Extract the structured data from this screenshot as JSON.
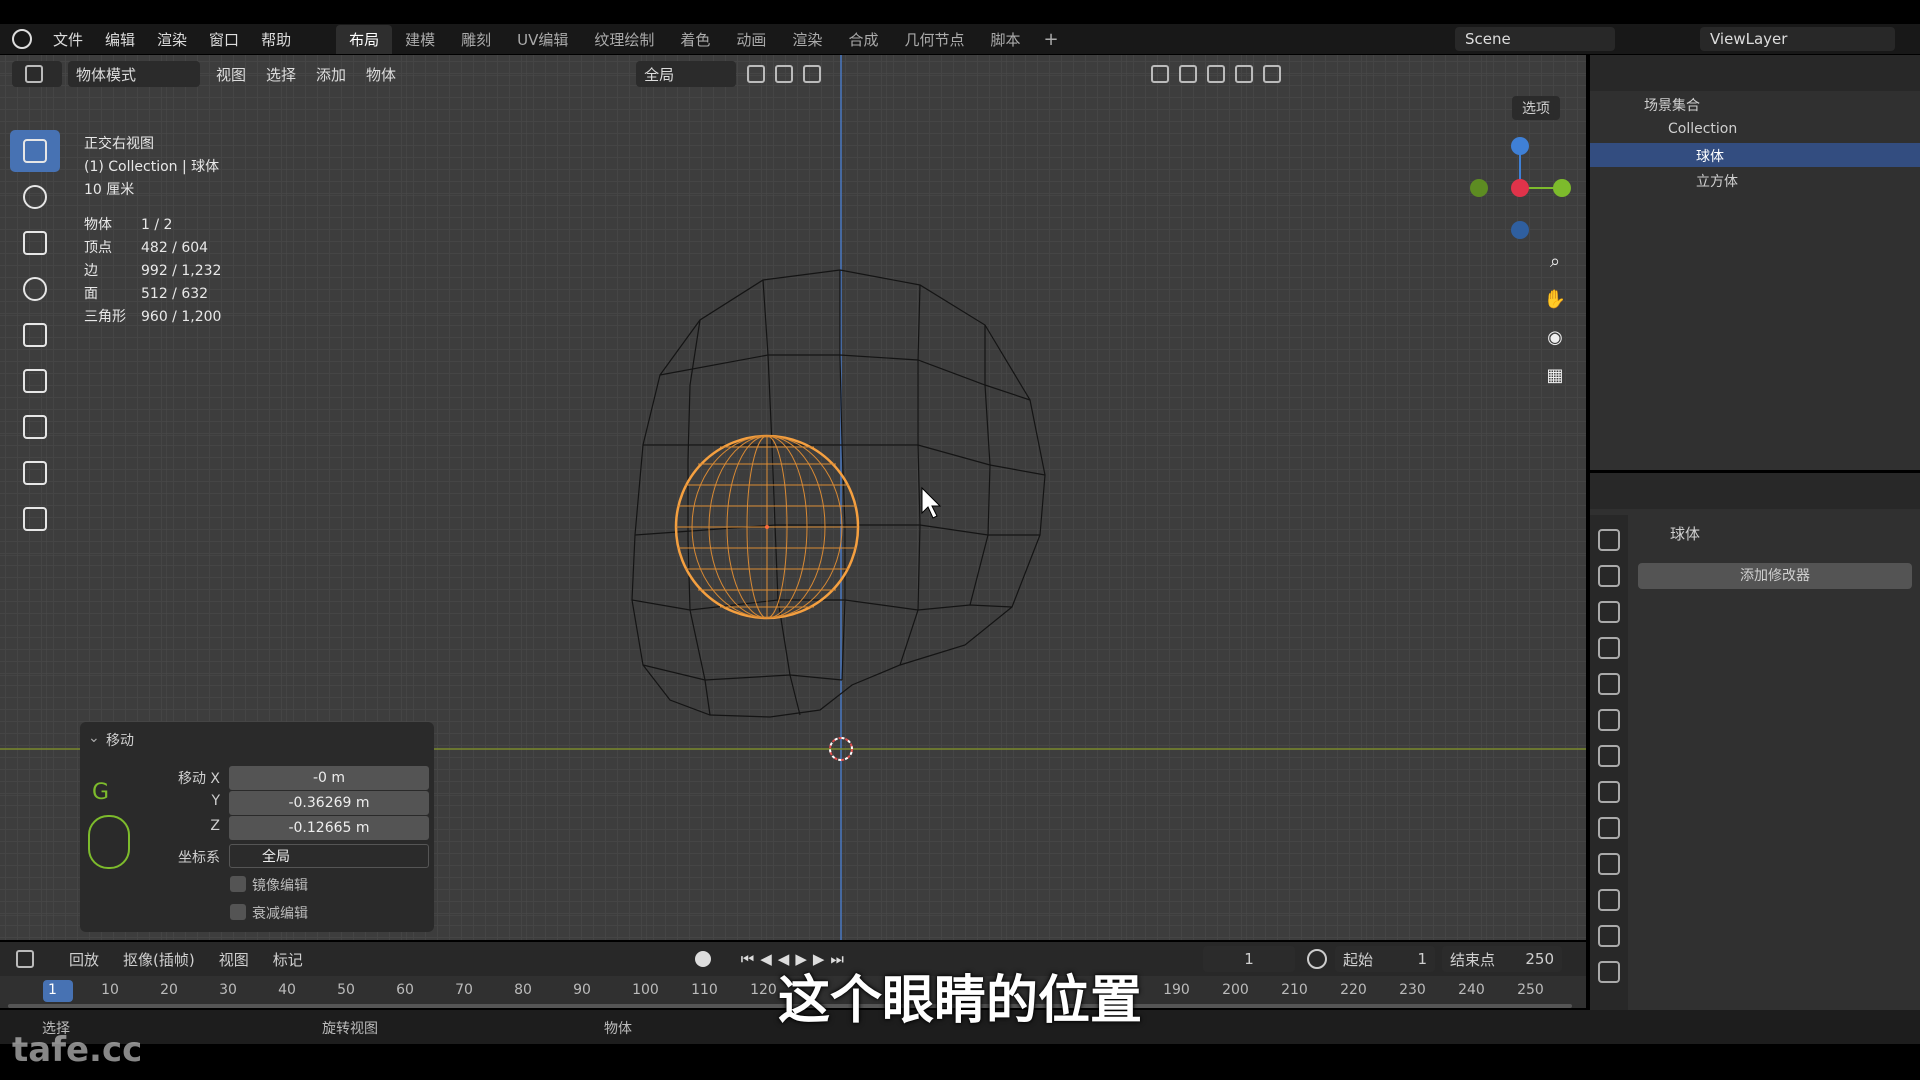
{
  "menus": [
    "文件",
    "编辑",
    "渲染",
    "窗口",
    "帮助"
  ],
  "workspaces": [
    "布局",
    "建模",
    "雕刻",
    "UV编辑",
    "纹理绘制",
    "着色",
    "动画",
    "渲染",
    "合成",
    "几何节点",
    "脚本"
  ],
  "active_workspace": "布局",
  "scene": "Scene",
  "view_layer": "ViewLayer",
  "viewport_header": {
    "mode": "物体模式",
    "items": [
      "视图",
      "选择",
      "添加",
      "物体"
    ],
    "transform": "全局"
  },
  "options_label": "选项",
  "viewport_info": {
    "view": "正交右视图",
    "collection": "(1) Collection | 球体",
    "scale": "10 厘米"
  },
  "stats": [
    {
      "k": "物体",
      "v": "1 / 2"
    },
    {
      "k": "顶点",
      "v": "482 / 604"
    },
    {
      "k": "边",
      "v": "992 / 1,232"
    },
    {
      "k": "面",
      "v": "512 / 632"
    },
    {
      "k": "三角形",
      "v": "960 / 1,200"
    }
  ],
  "operator": {
    "title": "移动",
    "shortcut": "G",
    "move_x_label": "移动 X",
    "move_x": "-0 m",
    "y_label": "Y",
    "move_y": "-0.36269 m",
    "z_label": "Z",
    "move_z": "-0.12665 m",
    "orient_label": "坐标系",
    "orient": "全局",
    "mirror": "镜像编辑",
    "proportional": "衰减编辑"
  },
  "outliner": {
    "root": "场景集合",
    "collection": "Collection",
    "items": [
      {
        "name": "球体",
        "selected": true
      },
      {
        "name": "立方体",
        "selected": false
      }
    ]
  },
  "properties": {
    "object": "球体",
    "add_modifier": "添加修改器"
  },
  "timeline": {
    "playback": "回放",
    "keying": "抠像(插帧)",
    "view": "视图",
    "marker": "标记",
    "current_frame": "1",
    "start_label": "起始",
    "start": "1",
    "end_label": "结束点",
    "end": "250",
    "ticks": [
      "1",
      "10",
      "20",
      "30",
      "40",
      "50",
      "60",
      "70",
      "80",
      "90",
      "100",
      "110",
      "120",
      "190",
      "200",
      "210",
      "220",
      "230",
      "240",
      "250"
    ]
  },
  "statusbar": {
    "select": "选择",
    "rotate": "旋转视图",
    "object": "物体"
  },
  "subtitle": "这个眼睛的位置",
  "watermark": "tafe.cc",
  "colors": {
    "accent": "#4772b3",
    "selection": "#f5a040",
    "x_axis": "#e0334a",
    "y_axis": "#7dbb2c",
    "z_axis": "#3f80d6"
  }
}
